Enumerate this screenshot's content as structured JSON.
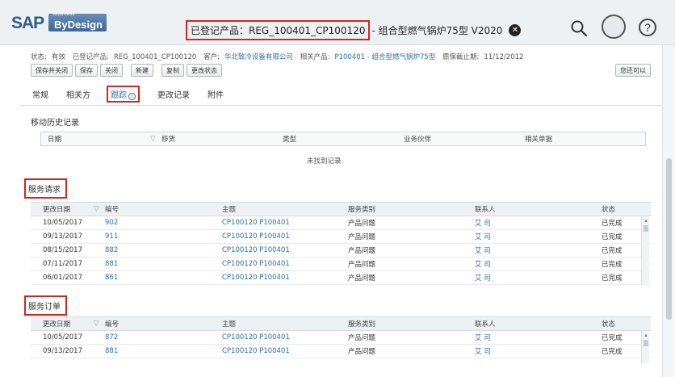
{
  "header": {
    "logo_main": "SAP",
    "logo_small": "Business",
    "logo_sub": "ByDesign",
    "title_highlighted": "已登记产品：REG_100401_CP100120",
    "title_rest": "- 组合型燃气锅炉75型 V2020",
    "close_glyph": "✕",
    "help_glyph": "?"
  },
  "info": {
    "status_label": "状态:",
    "status_value": "有效",
    "product_label": "已登记产品:",
    "product_value": "REG_100401_CP100120",
    "customer_label": "客户:",
    "customer_value": "华北致冷设备有限公司",
    "related_label": "相关产品:",
    "related_value": "P100401 - 组合型燃气锅炉75型",
    "warranty_label": "质保截止期:",
    "warranty_value": "11/12/2012"
  },
  "toolbar": {
    "save_close": "保存并关闭",
    "save": "保存",
    "close": "关闭",
    "new": "新建",
    "copy": "复制",
    "change_status": "更改状态",
    "more": "您还可以"
  },
  "tabs": [
    {
      "label": "常规",
      "active": false
    },
    {
      "label": "相关方",
      "active": false
    },
    {
      "label": "跟踪",
      "active": true
    },
    {
      "label": "更改记录",
      "active": false
    },
    {
      "label": "附件",
      "active": false
    }
  ],
  "history": {
    "title": "移动历史记录",
    "columns": [
      "日期",
      "移货",
      "类型",
      "业务伙伴",
      "相关单据"
    ],
    "empty_text": "未找到记录"
  },
  "service_requests": {
    "title": "服务请求",
    "columns": [
      "更改日期",
      "编号",
      "主题",
      "服务类别",
      "联系人",
      "状态"
    ],
    "rows": [
      {
        "date": "10/05/2017",
        "id": "902",
        "topic": "CP100120 P100401",
        "category": "产品问题",
        "contact": "艾 司",
        "status": "已完成"
      },
      {
        "date": "09/13/2017",
        "id": "911",
        "topic": "CP100120 P100401",
        "category": "产品问题",
        "contact": "艾 司",
        "status": "已完成"
      },
      {
        "date": "08/15/2017",
        "id": "882",
        "topic": "CP100120 P100401",
        "category": "产品问题",
        "contact": "艾 司",
        "status": "已完成"
      },
      {
        "date": "07/11/2017",
        "id": "881",
        "topic": "CP100120 P100401",
        "category": "产品问题",
        "contact": "艾 司",
        "status": "已完成"
      },
      {
        "date": "06/01/2017",
        "id": "861",
        "topic": "CP100120 P100401",
        "category": "产品问题",
        "contact": "艾 司",
        "status": "已完成"
      }
    ]
  },
  "service_orders": {
    "title": "服务订单",
    "columns": [
      "更改日期",
      "编号",
      "主题",
      "服务类别",
      "联系人",
      "状态"
    ],
    "rows": [
      {
        "date": "10/05/2017",
        "id": "872",
        "topic": "CP100120 P100401",
        "category": "产品问题",
        "contact": "艾 司",
        "status": "已完成"
      },
      {
        "date": "09/13/2017",
        "id": "881",
        "topic": "CP100120 P100401",
        "category": "产品问题",
        "contact": "艾 司",
        "status": "已完成"
      }
    ]
  },
  "colors": {
    "accent": "#2a6db0",
    "highlight_border": "#d9241c",
    "header_bg": "#eef1f4"
  }
}
